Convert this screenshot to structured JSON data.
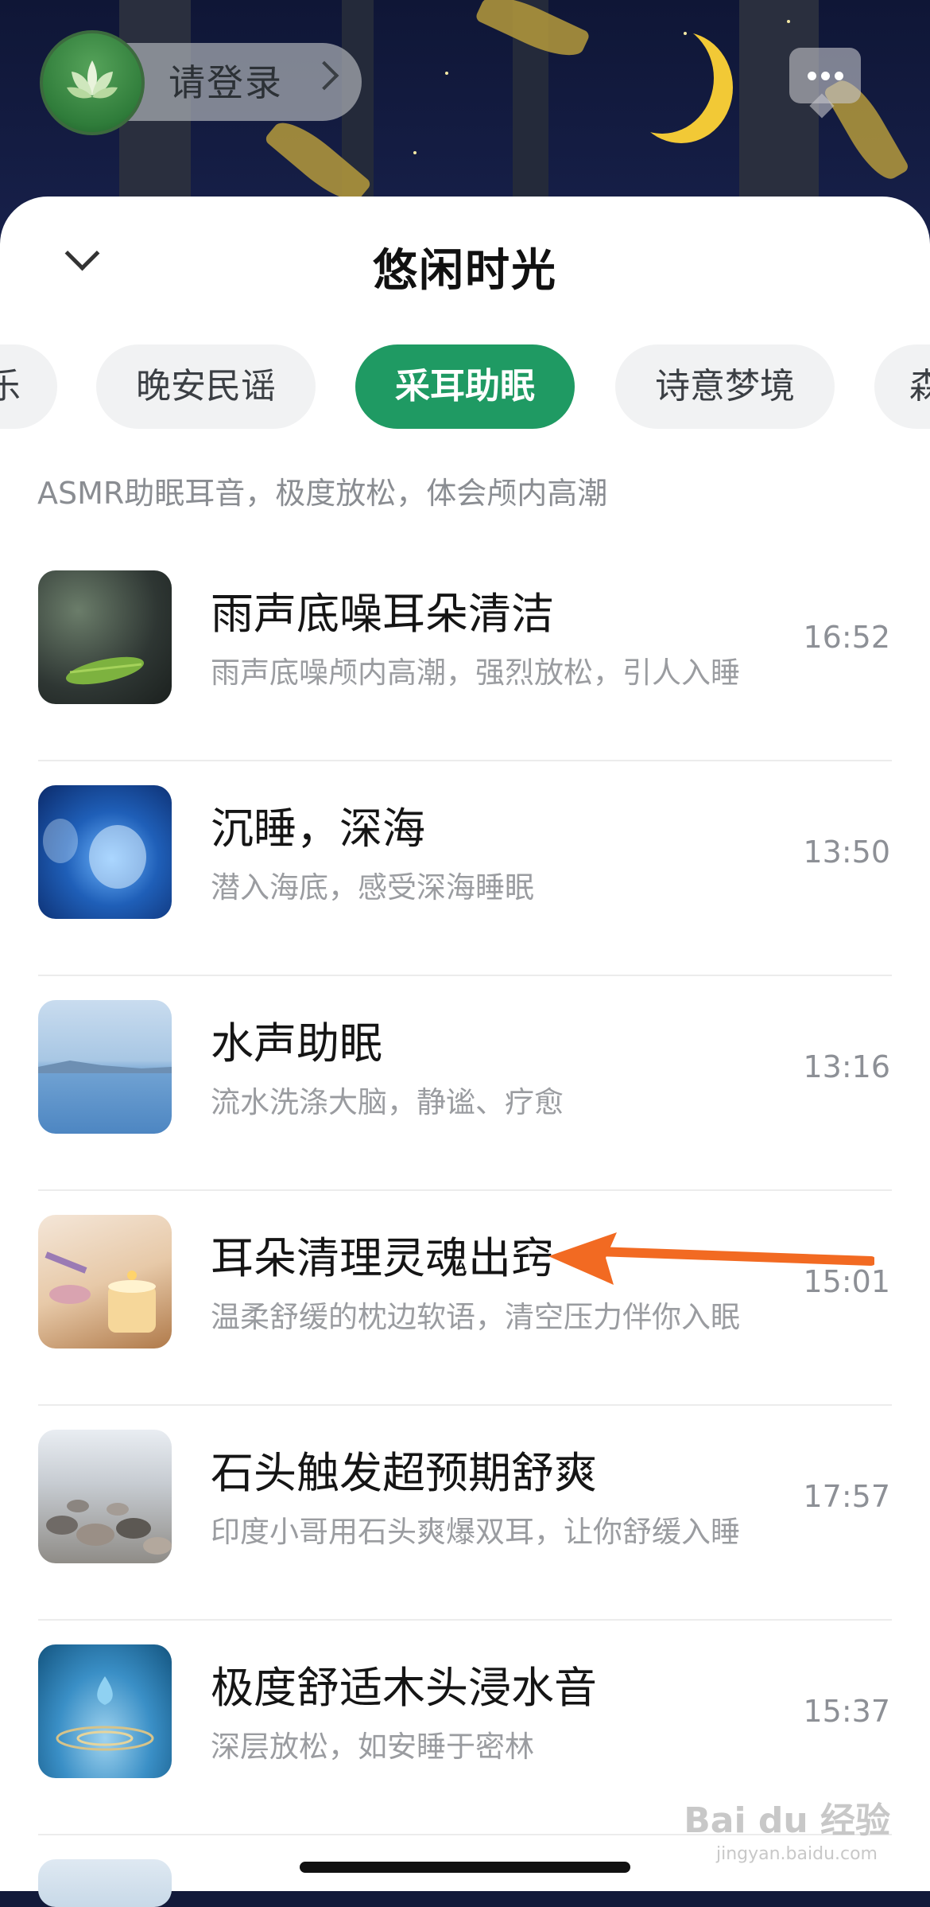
{
  "header": {
    "login_label": "请登录",
    "chat_icon": "chat-bubble-icon",
    "avatar_icon": "lotus-avatar-icon"
  },
  "sheet": {
    "title": "悠闲时光",
    "collapse_icon": "chevron-down-icon"
  },
  "tabs": [
    {
      "label": "乐",
      "active": false
    },
    {
      "label": "晚安民谣",
      "active": false
    },
    {
      "label": "采耳助眠",
      "active": true
    },
    {
      "label": "诗意梦境",
      "active": false
    },
    {
      "label": "森",
      "active": false
    }
  ],
  "category_description": "ASMR助眠耳音，极度放松，体会颅内高潮",
  "tracks": [
    {
      "title": "雨声底噪耳朵清洁",
      "desc": "雨声底噪颅内高潮，强烈放松，引人入睡",
      "duration": "16:52"
    },
    {
      "title": "沉睡，深海",
      "desc": "潜入海底，感受深海睡眠",
      "duration": "13:50"
    },
    {
      "title": "水声助眠",
      "desc": "流水洗涤大脑，静谧、疗愈",
      "duration": "13:16"
    },
    {
      "title": "耳朵清理灵魂出窍",
      "desc": "温柔舒缓的枕边软语，清空压力伴你入眠",
      "duration": "15:01"
    },
    {
      "title": "石头触发超预期舒爽",
      "desc": "印度小哥用石头爽爆双耳，让你舒缓入睡",
      "duration": "17:57"
    },
    {
      "title": "极度舒适木头浸水音",
      "desc": "深层放松，如安睡于密林",
      "duration": "15:37"
    }
  ],
  "colors": {
    "accent": "#1f9a63",
    "annotation_arrow": "#f26a22"
  },
  "watermark": {
    "text": "Bai du 经验",
    "url": "jingyan.baidu.com"
  }
}
